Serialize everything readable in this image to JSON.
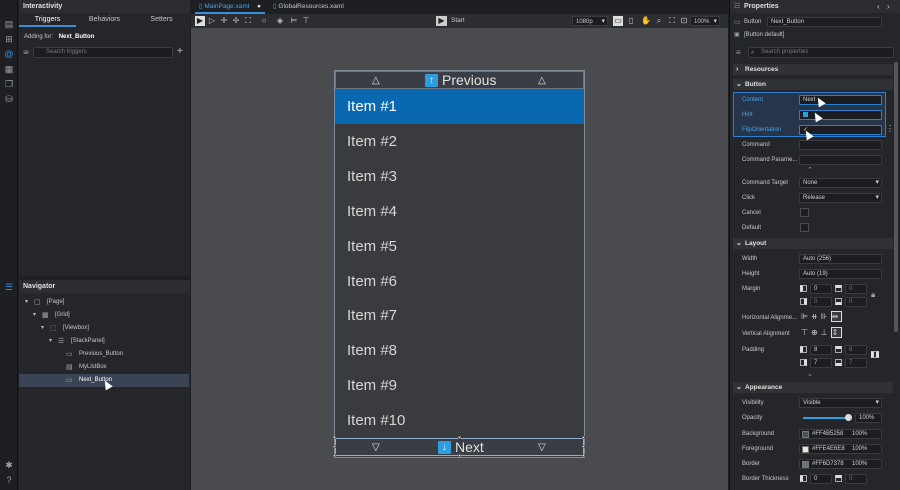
{
  "interactivity": {
    "title": "Interactivity",
    "tabs": [
      "Triggers",
      "Behaviors",
      "Setters"
    ],
    "adding_for_label": "Adding for:",
    "adding_for_value": "Next_Button",
    "search_placeholder": "Search triggers",
    "add_glyph": "+"
  },
  "navigator": {
    "title": "Navigator",
    "items": [
      {
        "label": "[Page]",
        "depth": 0,
        "expander": "▾",
        "icon": "▢"
      },
      {
        "label": "[Grid]",
        "depth": 1,
        "expander": "▾",
        "icon": "▦"
      },
      {
        "label": "[Viewbox]",
        "depth": 2,
        "expander": "▾",
        "icon": "⬚"
      },
      {
        "label": "[StackPanel]",
        "depth": 3,
        "expander": "▾",
        "icon": "☰"
      },
      {
        "label": "Previous_Button",
        "depth": 4,
        "expander": "",
        "icon": "▭"
      },
      {
        "label": "MyListBox",
        "depth": 4,
        "expander": "",
        "icon": "▤"
      },
      {
        "label": "Next_Button",
        "depth": 4,
        "expander": "",
        "icon": "▭"
      }
    ]
  },
  "document_tabs": [
    {
      "label": "MainPage.xaml",
      "active": true,
      "modified": "●"
    },
    {
      "label": "GlobalResources.xaml",
      "active": false,
      "modified": ""
    }
  ],
  "toolbar": {
    "start_label": "Start",
    "resolution": "1080p",
    "zoom": "100%"
  },
  "listbox": {
    "previous_label": "Previous",
    "next_label": "Next",
    "items": [
      "Item #1",
      "Item #2",
      "Item #3",
      "Item #4",
      "Item #5",
      "Item #6",
      "Item #7",
      "Item #8",
      "Item #9",
      "Item #10"
    ],
    "selected_index": 0
  },
  "properties": {
    "title": "Properties",
    "element_type": "Button",
    "element_name": "Next_Button",
    "style": "[Button default]",
    "search_placeholder": "Search properties",
    "sections": {
      "resources": "Resources",
      "button": "Button",
      "layout": "Layout",
      "appearance": "Appearance"
    },
    "button": {
      "content_label": "Content",
      "content_value": "Next",
      "hint_label": "Hint",
      "flip_label": "FlipOrientation",
      "command_label": "Command",
      "command_param_label": "Command Parame...",
      "command_target_label": "Command Target",
      "command_target_value": "None",
      "click_label": "Click",
      "click_value": "Release",
      "cancel_label": "Cancel",
      "default_label": "Default"
    },
    "layout": {
      "width_label": "Width",
      "width_value": "Auto (256)",
      "height_label": "Height",
      "height_value": "Auto (19)",
      "margin_label": "Margin",
      "margin_values": [
        "0",
        "0",
        "0",
        "0"
      ],
      "halign_label": "Horizontal Alignme...",
      "valign_label": "Vertical Alignment",
      "padding_label": "Padding",
      "padding_values": [
        "8",
        "8",
        "7",
        "7"
      ]
    },
    "appearance": {
      "visibility_label": "Visibility",
      "visibility_value": "Visible",
      "opacity_label": "Opacity",
      "opacity_value": "100%",
      "opacity_fraction": 1.0,
      "background_label": "Background",
      "background_value": "#FF4B5258",
      "background_pct": "100%",
      "background_color": "#4B5258",
      "foreground_label": "Foreground",
      "foreground_value": "#FFE4E6E8",
      "foreground_pct": "100%",
      "foreground_color": "#E4E6E8",
      "border_label": "Border",
      "border_value": "#FF6D7378",
      "border_pct": "100%",
      "border_color": "#6D7378",
      "border_thickness_label": "Border Thickness",
      "border_thickness_values": [
        "0",
        "0"
      ]
    }
  },
  "colors": {
    "accent": "#0a68b0",
    "highlight": "#2d9ee0"
  }
}
